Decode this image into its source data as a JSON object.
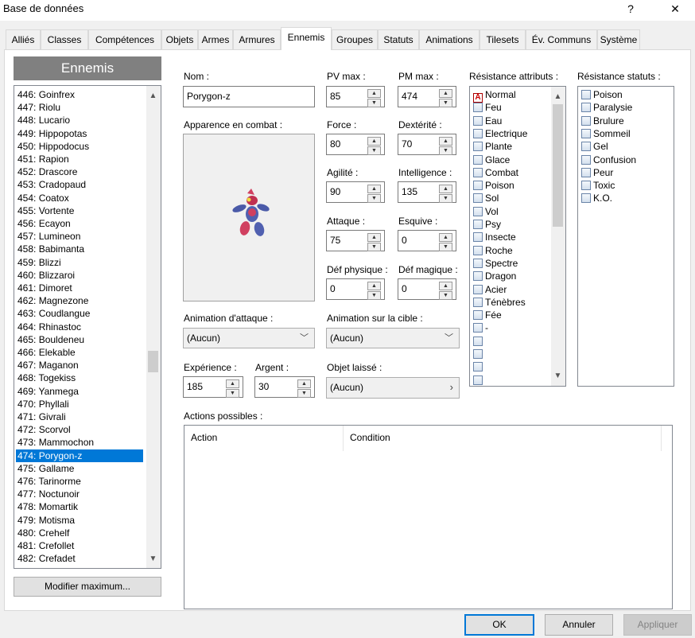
{
  "window": {
    "title": "Base de données",
    "help": "?",
    "close": "✕"
  },
  "tabs": [
    "Alliés",
    "Classes",
    "Compétences",
    "Objets",
    "Armes",
    "Armures",
    "Ennemis",
    "Groupes",
    "Statuts",
    "Animations",
    "Tilesets",
    "Év. Communs",
    "Système"
  ],
  "sidebar": {
    "title": "Ennemis",
    "items": [
      "446: Goinfrex",
      "447: Riolu",
      "448: Lucario",
      "449: Hippopotas",
      "450: Hippodocus",
      "451: Rapion",
      "452: Drascore",
      "453: Cradopaud",
      "454: Coatox",
      "455: Vortente",
      "456: Ecayon",
      "457: Lumineon",
      "458: Babimanta",
      "459: Blizzi",
      "460: Blizzaroi",
      "461: Dimoret",
      "462: Magnezone",
      "463: Coudlangue",
      "464: Rhinastoc",
      "465: Bouldeneu",
      "466: Elekable",
      "467: Maganon",
      "468: Togekiss",
      "469: Yanmega",
      "470: Phyllali",
      "471: Givrali",
      "472: Scorvol",
      "473: Mammochon",
      "474: Porygon-z",
      "475: Gallame",
      "476: Tarinorme",
      "477: Noctunoir",
      "478: Momartik",
      "479: Motisma",
      "480: Crehelf",
      "481: Crefollet",
      "482: Crefadet"
    ],
    "selected": "474: Porygon-z",
    "modify_button": "Modifier maximum..."
  },
  "form": {
    "name_label": "Nom :",
    "name_value": "Porygon-z",
    "appearance_label": "Apparence en combat :",
    "attack_anim_label": "Animation d'attaque :",
    "attack_anim_value": "(Aucun)",
    "target_anim_label": "Animation sur la cible :",
    "target_anim_value": "(Aucun)",
    "exp_label": "Expérience :",
    "exp_value": "185",
    "gold_label": "Argent :",
    "gold_value": "30",
    "item_label": "Objet laissé :",
    "item_value": "(Aucun)",
    "actions_label": "Actions possibles :",
    "actions_columns": [
      "Action",
      "Condition"
    ]
  },
  "stats": {
    "pv_label": "PV max :",
    "pv": "85",
    "pm_label": "PM max :",
    "pm": "474",
    "force_label": "Force :",
    "force": "80",
    "dex_label": "Dextérité :",
    "dex": "70",
    "agi_label": "Agilité :",
    "agi": "90",
    "int_label": "Intelligence :",
    "int": "135",
    "atk_label": "Attaque :",
    "atk": "75",
    "eva_label": "Esquive :",
    "eva": "0",
    "pdef_label": "Déf physique :",
    "pdef": "0",
    "mdef_label": "Déf magique :",
    "mdef": "0"
  },
  "attr_resist": {
    "label": "Résistance attributs :",
    "items": [
      {
        "name": "Normal",
        "mark": "A"
      },
      {
        "name": "Feu",
        "mark": ""
      },
      {
        "name": "Eau",
        "mark": ""
      },
      {
        "name": "Electrique",
        "mark": ""
      },
      {
        "name": "Plante",
        "mark": ""
      },
      {
        "name": "Glace",
        "mark": ""
      },
      {
        "name": "Combat",
        "mark": ""
      },
      {
        "name": "Poison",
        "mark": ""
      },
      {
        "name": "Sol",
        "mark": ""
      },
      {
        "name": "Vol",
        "mark": ""
      },
      {
        "name": "Psy",
        "mark": ""
      },
      {
        "name": "Insecte",
        "mark": ""
      },
      {
        "name": "Roche",
        "mark": ""
      },
      {
        "name": "Spectre",
        "mark": ""
      },
      {
        "name": "Dragon",
        "mark": ""
      },
      {
        "name": "Acier",
        "mark": ""
      },
      {
        "name": "Ténèbres",
        "mark": ""
      },
      {
        "name": "Fée",
        "mark": ""
      },
      {
        "name": "-",
        "mark": ""
      },
      {
        "name": "",
        "mark": ""
      },
      {
        "name": "",
        "mark": ""
      },
      {
        "name": "",
        "mark": ""
      },
      {
        "name": "",
        "mark": ""
      }
    ]
  },
  "status_resist": {
    "label": "Résistance statuts :",
    "items": [
      "Poison",
      "Paralysie",
      "Brulure",
      "Sommeil",
      "Gel",
      "Confusion",
      "Peur",
      "Toxic",
      "K.O."
    ]
  },
  "footer": {
    "ok": "OK",
    "cancel": "Annuler",
    "apply": "Appliquer"
  },
  "colors": {
    "selection": "#0078d7",
    "header_gray": "#808080"
  }
}
